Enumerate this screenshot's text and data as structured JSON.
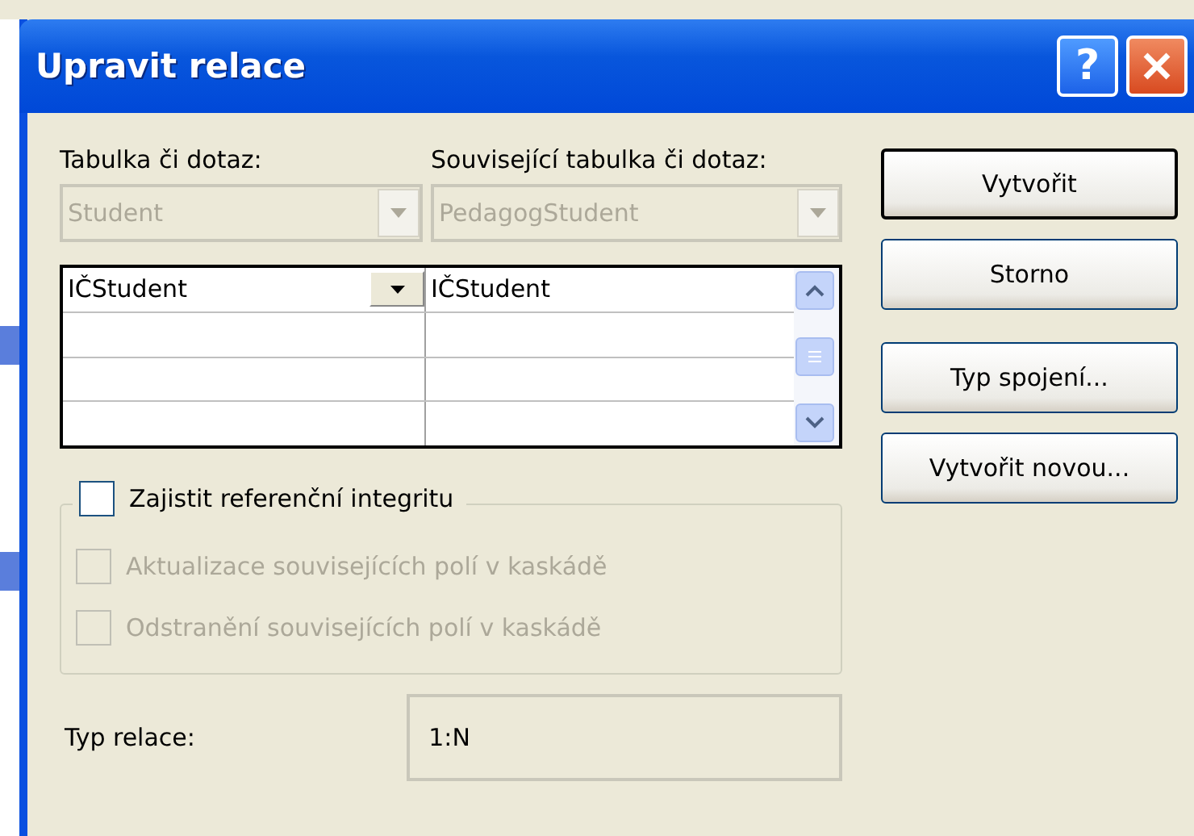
{
  "window": {
    "title": "Upravit relace"
  },
  "title_buttons": [
    {
      "kind": "help",
      "label": "?"
    },
    {
      "kind": "close"
    }
  ],
  "table_label": "Tabulka či dotaz:",
  "related_label": "Související tabulka či dotaz:",
  "table_combo": {
    "value": "Student",
    "disabled": true
  },
  "related_combo": {
    "value": "PedagogStudent",
    "disabled": true
  },
  "field_grid": {
    "rows": [
      {
        "column_1": "IČStudent",
        "column_2": "IČStudent",
        "selected": true
      }
    ]
  },
  "integrity": {
    "label": "Zajistit referenční integritu",
    "checked": false,
    "disabled": false
  },
  "options": [
    {
      "label": "Aktualizace souvisejících polí v kaskádě",
      "checked": false,
      "disabled": true
    },
    {
      "label": "Odstranění souvisejících polí v kaskádě",
      "checked": false,
      "disabled": true
    }
  ],
  "relation_type": {
    "label": "Typ relace:",
    "value": "1:N"
  },
  "buttons": [
    {
      "label": "Vytvořit",
      "default": true
    },
    {
      "label": "Storno",
      "default": false
    },
    {
      "label": "Typ spojení...",
      "default": false
    },
    {
      "label": "Vytvořit novou...",
      "default": false
    }
  ]
}
